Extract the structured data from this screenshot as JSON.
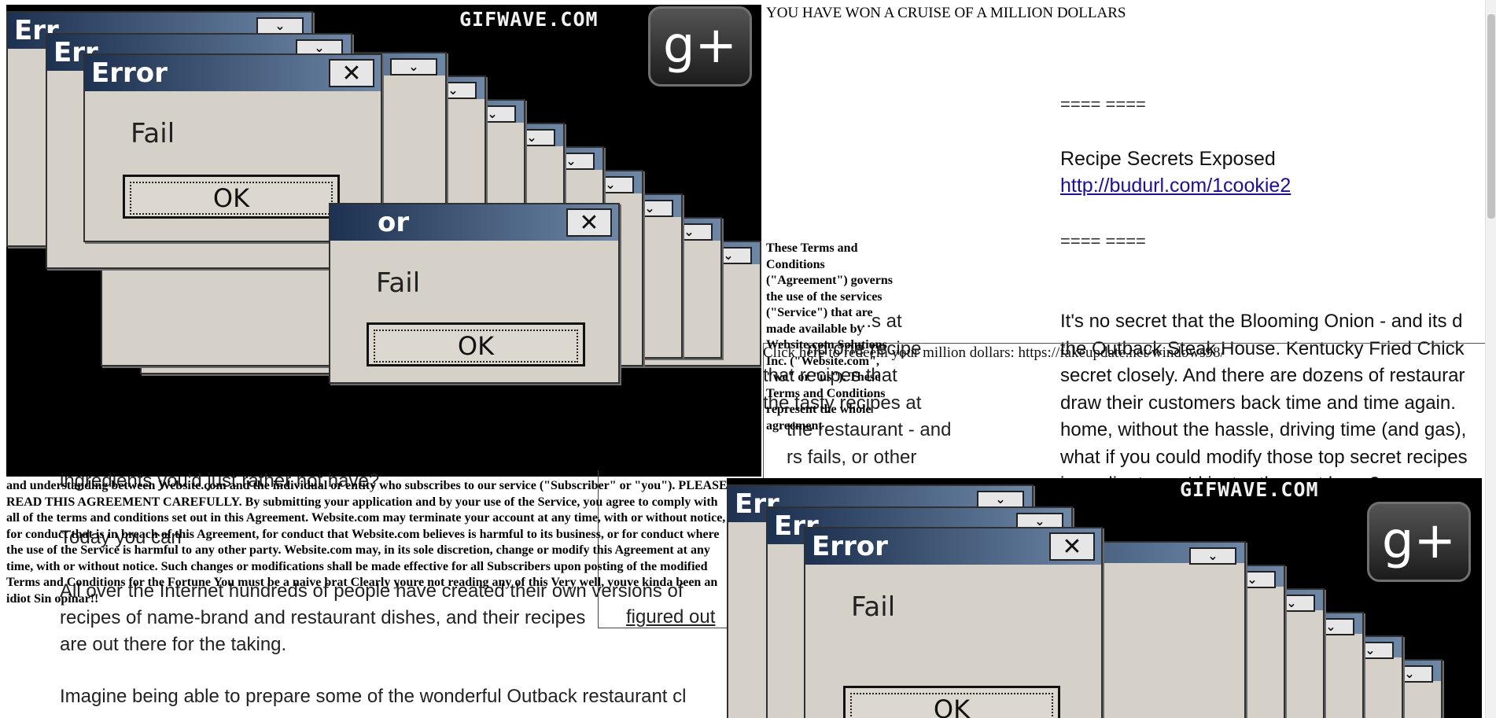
{
  "gif": {
    "watermark": "GIFWAVE.COM",
    "gplus_label": "g+",
    "error_title": "Error",
    "error_title_partial": "Err",
    "error_title_cut": "or",
    "error_message": "Fail",
    "ok_label": "OK",
    "close_label": "✕",
    "minimize_label": "⌄"
  },
  "headline": "YOU HAVE WON A CRUISE OF A MILLION DOLLARS",
  "redeem_text": "Click here to redeem your million dollars: https://fakeupdate.net/windows98/",
  "recipe": {
    "separator": "==== ====",
    "title": "Recipe Secrets Exposed",
    "link": "http://budurl.com/1cookie2",
    "separator2": "==== ====",
    "para_lines": [
      "It's no secret that the Blooming Onion - and its d",
      "the Outback Steak House. Kentucky Fried Chick",
      "secret closely. And there are dozens of restaurar",
      "draw their customers back time and time again.",
      "home, without the hassle, driving time (and gas),",
      "what if you could modify those top secret recipes",
      "ingredients you'd just rather not have?"
    ]
  },
  "middle_fragments": [
    "...s at",
    "nd one recipe",
    "that recipes that",
    "the tasty recipes at",
    "the restaurant - and",
    "rs fails, or other"
  ],
  "terms_narrow": "These Terms and Conditions (\"Agreement\") governs the use of the services (\"Service\") that are made available by Website.com Solutions Inc. (\"Website.com\", \"we\" or \"us\"). These Terms and Conditions represent the whole agreement",
  "terms_wide": "and understanding between Website.com and the individual or entity who subscribes to our service (\"Subscriber\" or \"you\"). PLEASE READ THIS AGREEMENT CAREFULLY. By submitting your application and by your use of the Service, you agree to comply with all of the terms and conditions set out in this Agreement. Website.com may terminate your account at any time, with or without notice, for conduct that is in breach of this Agreement, for conduct that Website.com believes is harmful to its business, or for conduct where the use of the Service is harmful to any other party. Website.com may, in its sole discretion, change or modify this Agreement at any time, with or without notice. Such changes or modifications shall be made effective for all Subscribers upon posting of the modified Terms and Conditions for the Fortune You must be a naive brat Clearly youre not reading any of this Very well, youve kinda been an idiot Sin opinar!!",
  "lower_left": {
    "ingredients": "ingredients you'd just rather not have?",
    "today": "Today you can",
    "para1": "All over the Internet hundreds of people have created their own versions of",
    "para2": "recipes of name-brand and restaurant dishes, and their recipes",
    "para3": "are out there for the taking.",
    "para4": "Imagine being able to prepare some of the wonderful Outback restaurant cl",
    "figured_out": "figured out"
  },
  "right_edge_letter": "e"
}
